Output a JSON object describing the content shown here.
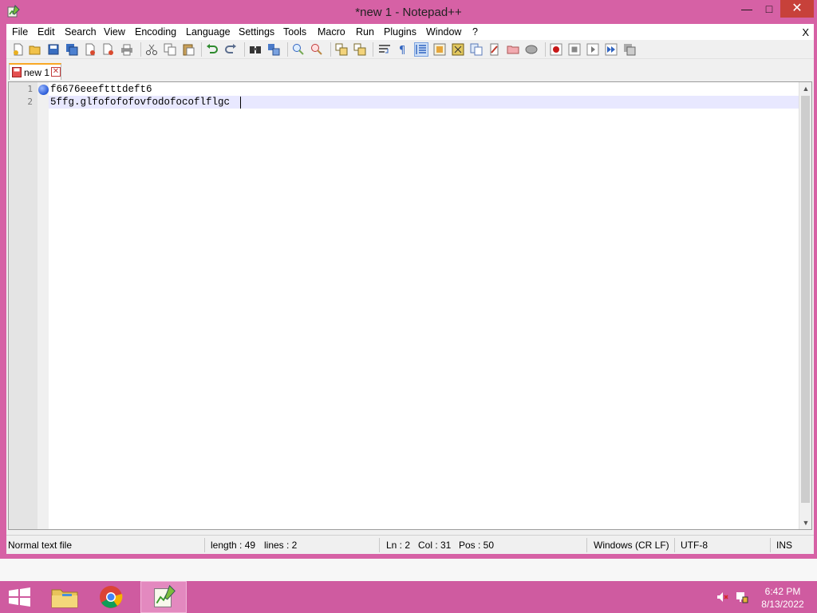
{
  "window": {
    "title": "*new 1 - Notepad++",
    "min": "—",
    "max": "□",
    "close": "✕"
  },
  "menu": {
    "items": [
      "File",
      "Edit",
      "Search",
      "View",
      "Encoding",
      "Language",
      "Settings",
      "Tools",
      "Macro",
      "Run",
      "Plugins",
      "Window",
      "?"
    ],
    "close": "X"
  },
  "toolbar": {
    "icons": [
      "new-file-icon",
      "open-file-icon",
      "save-icon",
      "save-all-icon",
      "close-icon",
      "close-all-icon",
      "print-icon",
      "cut-icon",
      "copy-icon",
      "paste-icon",
      "undo-icon",
      "redo-icon",
      "find-icon",
      "replace-icon",
      "zoom-in-icon",
      "zoom-out-icon",
      "sync-vertical-icon",
      "sync-horizontal-icon",
      "word-wrap-icon",
      "show-all-chars-icon",
      "indent-guide-icon",
      "udl-icon",
      "doc-map-icon",
      "function-list-icon",
      "folder-workspace-icon",
      "monitor-icon",
      "record-macro-icon",
      "stop-record-icon",
      "play-macro-icon",
      "run-macro-multiple-icon",
      "save-macro-icon"
    ]
  },
  "tab": {
    "label": "new 1",
    "close": "✕"
  },
  "editor": {
    "line_numbers": [
      "1",
      "2"
    ],
    "lines": [
      "f6676eeeftttdeft6",
      "5ffg.glfofofofovfodofocoflflgc"
    ],
    "scroll_up": "▲",
    "scroll_down": "▼"
  },
  "status": {
    "file_type": "Normal text file",
    "length": "length : 49",
    "lines": "lines : 2",
    "ln": "Ln : 2",
    "col": "Col : 31",
    "pos": "Pos : 50",
    "eol": "Windows (CR LF)",
    "encoding": "UTF-8",
    "mode": "INS"
  },
  "taskbar": {
    "apps": [
      "start-button",
      "file-explorer",
      "chrome",
      "notepad-plus-plus"
    ],
    "time": "6:42 PM",
    "date": "8/13/2022"
  }
}
